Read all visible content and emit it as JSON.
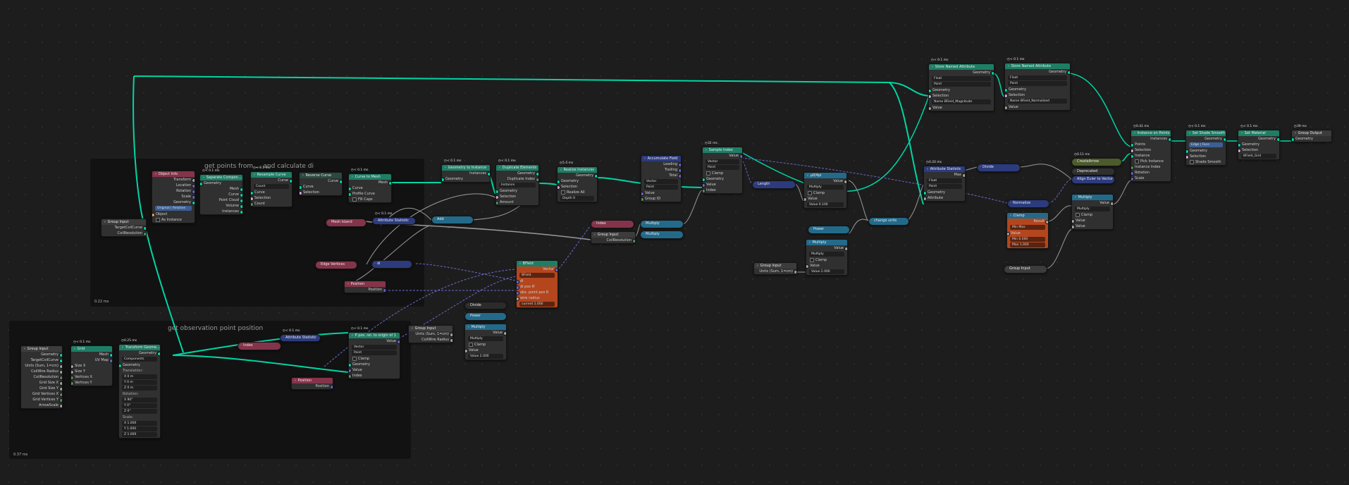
{
  "colors": {
    "geometry": "#00d6a3",
    "float": "#a1a1a1",
    "vector": "#6363c7",
    "integer": "#598c5c",
    "boolean": "#cca6d6",
    "geometry_header": "#1e7e65",
    "function_header": "#276380",
    "attribute_header": "#2c3b7d",
    "input_header": "#84344a",
    "converter_header": "#236a8a",
    "orange_node": "#b4461e"
  },
  "frames": [
    {
      "id": "f1",
      "label": "get points from ... and calculate di",
      "time": "0.22 ms"
    },
    {
      "id": "f2",
      "label": "get observation point position",
      "time": "0.37 ms"
    }
  ],
  "nodes": [
    {
      "id": "n_gi1",
      "title": "Group Input",
      "header": "#3c3c3c",
      "rows": [
        [
          "TargetCoilCurve",
          "r",
          "geo"
        ],
        [
          "CoilResolution",
          "r",
          "int"
        ]
      ]
    },
    {
      "id": "n_objinfo",
      "title": "Object Info",
      "header": "#84344a",
      "rows": [
        [
          "Transform",
          "r",
          "float"
        ],
        [
          "Location",
          "r",
          "vec"
        ],
        [
          "Rotation",
          "r",
          "vec"
        ],
        [
          "Scale",
          "r",
          "vec"
        ],
        [
          "Geometry",
          "r",
          "geo"
        ],
        [
          "Original | Relative",
          "t",
          ""
        ],
        [
          "Object",
          "l",
          "obj"
        ],
        [
          "As Instance",
          "c",
          ""
        ]
      ]
    },
    {
      "id": "n_sepcomp",
      "title": "Separate Compon...",
      "time": "< 0.1 ms",
      "header": "#1e7e65",
      "rows": [
        [
          "Geometry",
          "l",
          "geo"
        ],
        [
          "Mesh",
          "r",
          "geo"
        ],
        [
          "Curve",
          "r",
          "geo"
        ],
        [
          "Point Cloud",
          "r",
          "geo"
        ],
        [
          "Volume",
          "r",
          "geo"
        ],
        [
          "Instances",
          "r",
          "geo"
        ]
      ]
    },
    {
      "id": "n_resample",
      "title": "Resample Curve",
      "time": "< 0.1 ms",
      "header": "#1e7e65",
      "rows": [
        [
          "Curve",
          "r",
          "geo"
        ],
        [
          "Count",
          "f",
          ""
        ],
        [
          "Curve",
          "l",
          "geo"
        ],
        [
          "Selection",
          "l",
          "bool"
        ],
        [
          "Count",
          "l",
          "int"
        ]
      ]
    },
    {
      "id": "n_reverse",
      "title": "Reverse Curve",
      "header": "#2a4a41",
      "rows": [
        [
          "Curve",
          "r",
          "geo"
        ],
        [
          "Curve",
          "l",
          "geo"
        ],
        [
          "Selection",
          "l",
          "bool"
        ]
      ]
    },
    {
      "id": "n_c2m",
      "title": "Curve to Mesh",
      "time": "< 0.1 ms",
      "header": "#1e7e65",
      "rows": [
        [
          "Mesh",
          "r",
          "geo"
        ],
        [
          "Curve",
          "l",
          "geo"
        ],
        [
          "Profile Curve",
          "l",
          "geo"
        ],
        [
          "Fill Caps",
          "c",
          ""
        ]
      ]
    },
    {
      "id": "n_g2i",
      "title": "Geometry to Instance",
      "time": "< 0.1 ms",
      "header": "#1e7e65",
      "rows": [
        [
          "Instances",
          "r",
          "geo"
        ],
        [
          "Geometry",
          "l",
          "geo"
        ]
      ]
    },
    {
      "id": "n_dupl",
      "title": "Duplicate Elements",
      "time": "< 0.1 ms",
      "header": "#1e7e65",
      "rows": [
        [
          "Geometry",
          "r",
          "geo"
        ],
        [
          "Duplicate Index",
          "r",
          "int"
        ],
        [
          "Instance",
          "f",
          ""
        ],
        [
          "Geometry",
          "l",
          "geo"
        ],
        [
          "Selection",
          "l",
          "bool"
        ],
        [
          "Amount",
          "l",
          "int"
        ]
      ]
    },
    {
      "id": "n_realize",
      "title": "Realize Instances",
      "time": "5.4 ms",
      "header": "#1e7e65",
      "rows": [
        [
          "Geometry",
          "r",
          "geo"
        ],
        [
          "Geometry",
          "l",
          "geo"
        ],
        [
          "Selection",
          "l",
          "bool"
        ],
        [
          "Realize All",
          "c",
          ""
        ],
        [
          "Depth 0",
          "f",
          ""
        ]
      ]
    },
    {
      "id": "n_accum",
      "title": "Accumulate Field",
      "header": "#2c3b7d",
      "rows": [
        [
          "Leading",
          "r",
          "vec"
        ],
        [
          "Trailing",
          "r",
          "vec"
        ],
        [
          "Total",
          "r",
          "vec"
        ],
        [
          "Vector",
          "f",
          ""
        ],
        [
          "Point",
          "f",
          ""
        ],
        [
          "Value",
          "l",
          "vec"
        ],
        [
          "Group ID",
          "l",
          "int"
        ]
      ]
    },
    {
      "id": "n_sample",
      "title": "Sample Index",
      "time": "32 ms",
      "header": "#1e7e65",
      "rows": [
        [
          "Value",
          "r",
          "vec"
        ],
        [
          "Vector",
          "f",
          ""
        ],
        [
          "Point",
          "f",
          ""
        ],
        [
          "Clamp",
          "c",
          ""
        ],
        [
          "Geometry",
          "l",
          "geo"
        ],
        [
          "Value",
          "l",
          "vec"
        ],
        [
          "Index",
          "l",
          "int"
        ]
      ]
    },
    {
      "id": "n_attrstat1",
      "title": "Attribute Statistic",
      "time": "< 0.1 ms",
      "header": "#2c3b7d",
      "collapsed": true
    },
    {
      "id": "n_meshisland",
      "title": "Mesh Island",
      "header": "#84344a",
      "collapsed": true
    },
    {
      "id": "n_add",
      "title": "Add",
      "header": "#236a8a",
      "collapsed": true
    },
    {
      "id": "n_edgeverts",
      "title": "Edge Vertices",
      "header": "#84344a",
      "collapsed": true
    },
    {
      "id": "n_di",
      "title": "di",
      "header": "#2c3b7d",
      "collapsed": true
    },
    {
      "id": "n_position1",
      "title": "Position",
      "header": "#84344a",
      "rows": [
        [
          "Position",
          "r",
          "vec"
        ]
      ]
    },
    {
      "id": "n_index1",
      "title": "Index",
      "header": "#84344a",
      "collapsed": true
    },
    {
      "id": "n_mult1",
      "title": "Multiply",
      "header": "#236a8a",
      "collapsed": true
    },
    {
      "id": "n_mult2",
      "title": "Multiply",
      "header": "#236a8a",
      "collapsed": true
    },
    {
      "id": "n_gi2",
      "title": "Group Input",
      "header": "#3c3c3c",
      "rows": [
        [
          "CoilResolution",
          "r",
          "int"
        ]
      ]
    },
    {
      "id": "n_bfield",
      "title": "BField",
      "header": "#1e7e65",
      "orange": true,
      "rows": [
        [
          "Vector",
          "r",
          "vec"
        ],
        [
          "BField",
          "f",
          ""
        ],
        [
          "di",
          "l",
          "vec"
        ],
        [
          "di pos R'",
          "l",
          "vec"
        ],
        [
          "obs. point pos R",
          "l",
          "vec"
        ],
        [
          "wire radius",
          "l",
          "float"
        ],
        [
          "current 1.000",
          "f",
          ""
        ]
      ]
    },
    {
      "id": "n_length",
      "title": "Length",
      "header": "#2c3b7d",
      "collapsed": true
    },
    {
      "id": "n_mu0",
      "title": "μ0/4pi",
      "header": "#236a8a",
      "rows": [
        [
          "Value",
          "r",
          "float"
        ],
        [
          "Multiply",
          "f",
          ""
        ],
        [
          "Clamp",
          "c",
          ""
        ],
        [
          "Value",
          "l",
          "float"
        ],
        [
          "Value 0.100",
          "f",
          ""
        ]
      ]
    },
    {
      "id": "n_power1",
      "title": "Power",
      "header": "#236a8a",
      "collapsed": true
    },
    {
      "id": "n_mult3",
      "title": "Multiply",
      "header": "#236a8a",
      "rows": [
        [
          "Value",
          "r",
          "float"
        ],
        [
          "Multiply",
          "f",
          ""
        ],
        [
          "Clamp",
          "c",
          ""
        ],
        [
          "Value",
          "l",
          "float"
        ],
        [
          "Value 2.000",
          "f",
          ""
        ]
      ]
    },
    {
      "id": "n_gi3",
      "title": "Group Input",
      "header": "#3c3c3c",
      "rows": [
        [
          "Units (Sum, 1=cm)",
          "r",
          "float"
        ]
      ]
    },
    {
      "id": "n_changeunits",
      "title": "change units",
      "header": "#236a8a",
      "collapsed": true
    },
    {
      "id": "n_store1",
      "title": "Store Named Attribute",
      "time": "< 0.1 ms",
      "header": "#1e7e65",
      "rows": [
        [
          "Geometry",
          "r",
          "geo"
        ],
        [
          "Float",
          "f",
          ""
        ],
        [
          "Point",
          "f",
          ""
        ],
        [
          "Geometry",
          "l",
          "geo"
        ],
        [
          "Selection",
          "l",
          "bool"
        ],
        [
          "Name BField_Magnitude",
          "f",
          ""
        ],
        [
          "Value",
          "l",
          "float"
        ]
      ]
    },
    {
      "id": "n_store2",
      "title": "Store Named Attribute",
      "time": "< 0.1 ms",
      "header": "#1e7e65",
      "rows": [
        [
          "Geometry",
          "r",
          "geo"
        ],
        [
          "Float",
          "f",
          ""
        ],
        [
          "Point",
          "f",
          ""
        ],
        [
          "Geometry",
          "l",
          "geo"
        ],
        [
          "Selection",
          "l",
          "bool"
        ],
        [
          "Name BField_Normalized",
          "f",
          ""
        ],
        [
          "Value",
          "l",
          "float"
        ]
      ]
    },
    {
      "id": "n_attrstat2",
      "title": "Attribute Statistic",
      "time": "0.20 ms",
      "header": "#2c3b7d",
      "rows": [
        [
          "Max",
          "r",
          "float"
        ],
        [
          "Float",
          "f",
          ""
        ],
        [
          "Point",
          "f",
          ""
        ],
        [
          "Geometry",
          "l",
          "geo"
        ],
        [
          "Attribute",
          "l",
          "float"
        ]
      ]
    },
    {
      "id": "n_divide",
      "title": "Divide",
      "header": "#2c3b7d",
      "collapsed": true
    },
    {
      "id": "n_normalize",
      "title": "Normalize",
      "header": "#2c3b7d",
      "collapsed": true
    },
    {
      "id": "n_clamp",
      "title": "Clamp",
      "header": "#236a8a",
      "orange": true,
      "rows": [
        [
          "Result",
          "r",
          "float"
        ],
        [
          "Min Max",
          "f",
          ""
        ],
        [
          "Value",
          "l",
          "float"
        ],
        [
          "Min 0.000",
          "f",
          ""
        ],
        [
          "Max 1.000",
          "f",
          ""
        ]
      ]
    },
    {
      "id": "n_gi4",
      "title": "Group Input",
      "header": "#3c3c3c",
      "collapsed": true
    },
    {
      "id": "n_createarrow",
      "title": "CreateArrow",
      "time": "0.11 ms",
      "header": "#4d5a2c",
      "collapsed": true
    },
    {
      "id": "n_deprecated",
      "title": "Deprecated",
      "header": "#303030",
      "collapsed": true
    },
    {
      "id": "n_align",
      "title": "Align Euler to Vector",
      "header": "#2c3b7d",
      "collapsed": true
    },
    {
      "id": "n_mult4",
      "title": "Multiply",
      "header": "#236a8a",
      "rows": [
        [
          "Value",
          "r",
          "float"
        ],
        [
          "Multiply",
          "f",
          ""
        ],
        [
          "Clamp",
          "c",
          ""
        ],
        [
          "Value",
          "l",
          "float"
        ],
        [
          "Value",
          "l",
          "float"
        ]
      ]
    },
    {
      "id": "n_iop",
      "title": "Instance on Points",
      "time": "0.41 ms",
      "header": "#1e7e65",
      "rows": [
        [
          "Instances",
          "r",
          "geo"
        ],
        [
          "Points",
          "l",
          "geo"
        ],
        [
          "Selection",
          "l",
          "bool"
        ],
        [
          "Instance",
          "l",
          "geo"
        ],
        [
          "Pick Instance",
          "c",
          ""
        ],
        [
          "Instance Index",
          "l",
          "int"
        ],
        [
          "Rotation",
          "l",
          "vec"
        ],
        [
          "Scale",
          "l",
          "vec"
        ]
      ]
    },
    {
      "id": "n_shade",
      "title": "Set Shade Smooth",
      "time": "< 0.1 ms",
      "header": "#1e7e65",
      "rows": [
        [
          "Geometry",
          "r",
          "geo"
        ],
        [
          "Edge | Face",
          "t",
          ""
        ],
        [
          "Geometry",
          "l",
          "geo"
        ],
        [
          "Selection",
          "l",
          "bool"
        ],
        [
          "Shade Smooth",
          "c",
          ""
        ]
      ]
    },
    {
      "id": "n_setmat",
      "title": "Set Material",
      "time": "< 0.1 ms",
      "header": "#1e7e65",
      "rows": [
        [
          "Geometry",
          "r",
          "geo"
        ],
        [
          "Geometry",
          "l",
          "geo"
        ],
        [
          "Selection",
          "l",
          "bool"
        ],
        [
          "BField_Grid",
          "f",
          ""
        ]
      ]
    },
    {
      "id": "n_gout",
      "title": "Group Output",
      "time": "39 ms",
      "header": "#3c3c3c",
      "rows": [
        [
          "Geometry",
          "l",
          "geo"
        ]
      ]
    },
    {
      "id": "n_gi5",
      "title": "Group Input",
      "header": "#3c3c3c",
      "rows": [
        [
          "Geometry",
          "r",
          "geo"
        ],
        [
          "TargetCoilCurve",
          "r",
          "geo"
        ],
        [
          "Units (Sum, 1=cm)",
          "r",
          "float"
        ],
        [
          "CoilWire Radius",
          "r",
          "float"
        ],
        [
          "CoilResolution",
          "r",
          "int"
        ],
        [
          "Grid Size X",
          "r",
          "float"
        ],
        [
          "Grid Size Y",
          "r",
          "float"
        ],
        [
          "Grid Vertices X",
          "r",
          "int"
        ],
        [
          "Grid Vertices Y",
          "r",
          "int"
        ],
        [
          "ArrowScale",
          "r",
          "float"
        ]
      ]
    },
    {
      "id": "n_grid",
      "title": "Grid",
      "time": "< 0.1 ms",
      "header": "#1e7e65",
      "rows": [
        [
          "Mesh",
          "r",
          "geo"
        ],
        [
          "UV Map",
          "r",
          "vec"
        ],
        [
          "Size X",
          "l",
          "float"
        ],
        [
          "Size Y",
          "l",
          "float"
        ],
        [
          "Vertices X",
          "l",
          "int"
        ],
        [
          "Vertices Y",
          "l",
          "int"
        ]
      ]
    },
    {
      "id": "n_transform",
      "title": "Transform Geome...",
      "time": "0.25 ms",
      "header": "#1e7e65",
      "rows": [
        [
          "Geometry",
          "r",
          "geo"
        ],
        [
          "Components",
          "f",
          ""
        ],
        [
          "Geometry",
          "l",
          "geo"
        ],
        [
          "Translation:",
          "h",
          ""
        ],
        [
          "X 0 m",
          "f",
          ""
        ],
        [
          "Y 0 m",
          "f",
          ""
        ],
        [
          "Z 0 m",
          "f",
          ""
        ],
        [
          "Rotation:",
          "h",
          ""
        ],
        [
          "X 90°",
          "f",
          ""
        ],
        [
          "Y 0°",
          "f",
          ""
        ],
        [
          "Z 0°",
          "f",
          ""
        ],
        [
          "Scale:",
          "h",
          ""
        ],
        [
          "X 1.000",
          "f",
          ""
        ],
        [
          "Y 1.000",
          "f",
          ""
        ],
        [
          "Z 1.000",
          "f",
          ""
        ]
      ]
    },
    {
      "id": "n_index2",
      "title": "Index",
      "header": "#84344a",
      "collapsed": true
    },
    {
      "id": "n_attrstat3",
      "title": "Attribute Statistic",
      "time": "< 0.1 ms",
      "header": "#2c3b7d",
      "collapsed": true
    },
    {
      "id": "n_ppos",
      "title": "P pos. rel. to origin of 1",
      "time": "< 0.1 ms",
      "header": "#1e7e65",
      "rows": [
        [
          "Value",
          "r",
          "vec"
        ],
        [
          "Vector",
          "f",
          ""
        ],
        [
          "Point",
          "f",
          ""
        ],
        [
          "Clamp",
          "c",
          ""
        ],
        [
          "Geometry",
          "l",
          "geo"
        ],
        [
          "Value",
          "l",
          "vec"
        ],
        [
          "Index",
          "l",
          "int"
        ]
      ]
    },
    {
      "id": "n_position2",
      "title": "Position",
      "header": "#84344a",
      "rows": [
        [
          "Position",
          "r",
          "vec"
        ]
      ]
    },
    {
      "id": "n_gi6",
      "title": "Group Input",
      "header": "#3c3c3c",
      "rows": [
        [
          "Units (Sum, 1=cm)",
          "r",
          "float"
        ],
        [
          "CoilWire Radius",
          "r",
          "float"
        ]
      ]
    },
    {
      "id": "n_divide2",
      "title": "Divide",
      "header": "#2b2b2b",
      "collapsed": true
    },
    {
      "id": "n_power2",
      "title": "Power",
      "header": "#236a8a",
      "collapsed": true
    },
    {
      "id": "n_mult5",
      "title": "Multiply",
      "header": "#236a8a",
      "rows": [
        [
          "Value",
          "r",
          "float"
        ],
        [
          "Multiply",
          "f",
          ""
        ],
        [
          "Clamp",
          "c",
          ""
        ],
        [
          "Value",
          "l",
          "float"
        ],
        [
          "Value 2.000",
          "f",
          ""
        ]
      ]
    }
  ]
}
